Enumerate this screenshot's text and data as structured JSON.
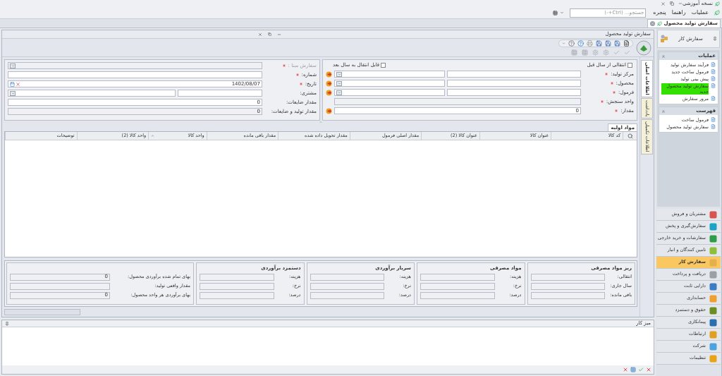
{
  "app": {
    "title": "نسخه آموزشی"
  },
  "menu": {
    "items": [
      "عملیات",
      "راهنما",
      "پنجره"
    ],
    "search": {
      "placeholder": "جستجو... (Ctrl+-)"
    }
  },
  "document_tabs": [
    {
      "label": "سفارش تولید محصول",
      "selected": true
    }
  ],
  "window": {
    "title": "سفارش تولید محصول"
  },
  "side_tabs": [
    {
      "label": "اطلاعات اصلی",
      "selected": true
    },
    {
      "label": "یادداشت",
      "selected": false
    },
    {
      "label": "اطلاعات تکمیلی",
      "selected": false
    }
  ],
  "form_right": {
    "checkboxes": [
      {
        "label": "انتقالی از سال قبل",
        "checked": false
      },
      {
        "label": "قابل انتقال به سال بعد",
        "checked": false
      }
    ],
    "fields": [
      {
        "label": "مرکز تولید:",
        "required": true,
        "kind": "lookup"
      },
      {
        "label": "محصول:",
        "required": true,
        "kind": "lookup"
      },
      {
        "label": "فرمول:",
        "required": true,
        "kind": "lookup"
      },
      {
        "label": "واحد سنجش:",
        "required": true,
        "kind": "readonly"
      },
      {
        "label": "مقدار:",
        "required": true,
        "kind": "number",
        "value": "0"
      }
    ]
  },
  "form_left": {
    "fields": [
      {
        "label": "سفارش مبنا :",
        "required": true,
        "kind": "combo",
        "disabled": true
      },
      {
        "label": "شماره:",
        "required": true,
        "kind": "text"
      },
      {
        "label": "تاریخ:",
        "required": true,
        "kind": "date",
        "value": "1402/08/07"
      },
      {
        "label": "مشتری:",
        "required": false,
        "kind": "pair"
      },
      {
        "label": "مقدار ضایعات:",
        "required": false,
        "kind": "text",
        "value": "0"
      },
      {
        "label": "مقدار تولید و ضایعات:",
        "required": false,
        "kind": "readonly",
        "value": "0"
      }
    ]
  },
  "table": {
    "tab": "مواد اولیه",
    "columns": [
      {
        "label": "کد کالا",
        "sorted": false
      },
      {
        "label": "عنوان کالا",
        "sorted": false
      },
      {
        "label": "عنوان کالا (2)",
        "sorted": false
      },
      {
        "label": "مقدار اصلی فرمول",
        "sorted": false
      },
      {
        "label": "مقدار تحویل داده شده",
        "sorted": false
      },
      {
        "label": "مقدار باقی مانده",
        "sorted": false
      },
      {
        "label": "واحد کالا",
        "sorted": true
      },
      {
        "label": "واحد کالا (2)",
        "sorted": false
      },
      {
        "label": "توضیحات",
        "sorted": false
      }
    ]
  },
  "cost_panels": [
    {
      "title": "ریز مواد مصرفی",
      "rows": [
        {
          "label": "انتقالی:"
        },
        {
          "label": "سال جاری:"
        },
        {
          "label": "باقی مانده:"
        }
      ]
    },
    {
      "title": "مواد مصرفی",
      "rows": [
        {
          "label": "هزینه:"
        },
        {
          "label": "نرخ:"
        },
        {
          "label": "درصد:"
        }
      ]
    },
    {
      "title": "سربار برآوردی",
      "rows": [
        {
          "label": "هزینه:"
        },
        {
          "label": "نرخ:"
        },
        {
          "label": "درصد:"
        }
      ]
    },
    {
      "title": "دستمزد برآوردی",
      "rows": [
        {
          "label": "هزینه:"
        },
        {
          "label": "نرخ:"
        },
        {
          "label": "درصد:"
        }
      ]
    }
  ],
  "summary": [
    {
      "label": "بهای تمام شده برآوردی محصول:",
      "value": "0"
    },
    {
      "label": "مقدار واقعی تولید:"
    },
    {
      "label": "بهای برآوردی هر واحد محصول:",
      "value": "0"
    }
  ],
  "desk": {
    "title": "میز کار"
  },
  "sidebar": {
    "title": "سفارش کار",
    "groups": [
      {
        "title": "عملیات",
        "items": [
          {
            "label": "فرآیند سفارش تولید",
            "selected": false
          },
          {
            "label": "فرمول ساخت جدید",
            "selected": false
          },
          {
            "label": "پیش بینی تولید",
            "selected": false
          },
          {
            "label": "سفارش تولید محصول جدید",
            "selected": true
          },
          {
            "label": "مرور سفارش",
            "selected": false
          }
        ]
      },
      {
        "title": "فهرست",
        "items": [
          {
            "label": "فرمول ساخت",
            "selected": false
          },
          {
            "label": "سفارش تولید محصول",
            "selected": false
          }
        ]
      }
    ],
    "nav": [
      {
        "label": "مشتریان و فروش",
        "selected": false,
        "color": "#d9534f"
      },
      {
        "label": "سفارش‌گیری و پخش",
        "selected": false,
        "color": "#1aa3c4"
      },
      {
        "label": "سفارشات و خرید خارجی",
        "selected": false,
        "color": "#2e9d4a"
      },
      {
        "label": "تامین کنندگان و انبار",
        "selected": false,
        "color": "#8fbf3a"
      },
      {
        "label": "سفارش کار",
        "selected": true,
        "color": "#e3b04b"
      },
      {
        "label": "دریافت و پرداخت",
        "selected": false,
        "color": "#9aa0a6"
      },
      {
        "label": "دارایی ثابت",
        "selected": false,
        "color": "#3b7dc4"
      },
      {
        "label": "حسابداری",
        "selected": false,
        "color": "#f0a030"
      },
      {
        "label": "حقوق و دستمزد",
        "selected": false,
        "color": "#6b8e23"
      },
      {
        "label": "پیمانکاری",
        "selected": false,
        "color": "#2a6fb0"
      },
      {
        "label": "ارتباطات",
        "selected": false,
        "color": "#e0a020"
      },
      {
        "label": "شرکت",
        "selected": false,
        "color": "#4aa3df"
      },
      {
        "label": "تنظیمات",
        "selected": false,
        "color": "#e8a317"
      }
    ]
  }
}
